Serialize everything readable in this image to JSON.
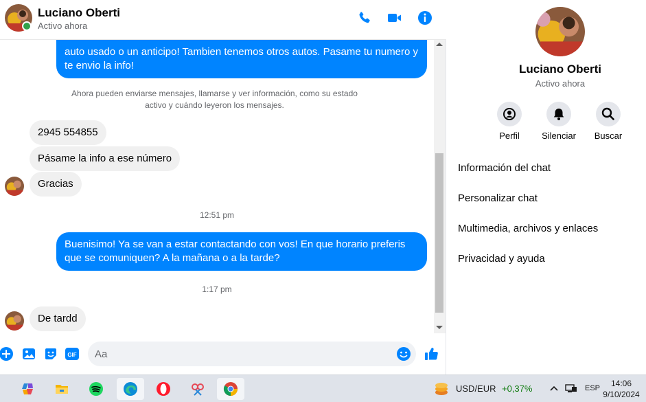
{
  "chat": {
    "contact_name": "Luciano Oberti",
    "contact_status": "Activo ahora",
    "messages": [
      {
        "type": "out",
        "text": "auto usado o un anticipo! Tambien tenemos otros autos. Pasame tu numero y te envio la info!"
      },
      {
        "type": "system",
        "text": "Ahora pueden enviarse mensajes, llamarse y ver información, como su estado activo y cuándo leyeron los mensajes."
      },
      {
        "type": "in",
        "text": "2945 554855"
      },
      {
        "type": "in",
        "text": "Pásame la info a ese número"
      },
      {
        "type": "in",
        "text": "Gracias"
      },
      {
        "type": "time",
        "text": "12:51 pm"
      },
      {
        "type": "out",
        "text": "Buenisimo! Ya se van a estar contactando con vos! En que horario preferis que se comuniquen? A la mañana o a la tarde?"
      },
      {
        "type": "time",
        "text": "1:17 pm"
      },
      {
        "type": "in",
        "text": "De tardd"
      }
    ],
    "composer": {
      "placeholder": "Aa",
      "value": ""
    }
  },
  "info_panel": {
    "name": "Luciano Oberti",
    "status": "Activo ahora",
    "actions": [
      "Perfil",
      "Silenciar",
      "Buscar"
    ],
    "menu": [
      "Información del chat",
      "Personalizar chat",
      "Multimedia, archivos y enlaces",
      "Privacidad y ayuda"
    ]
  },
  "taskbar": {
    "apps": [
      "copilot-icon",
      "file-explorer-icon",
      "spotify-icon",
      "edge-icon",
      "opera-icon",
      "snipping-tool-icon",
      "chrome-icon"
    ],
    "currency_pair": "USD/EUR",
    "currency_change": "+0,37%",
    "language": "ESP",
    "time": "14:06",
    "date": "9/10/2024"
  },
  "colors": {
    "accent": "#0084ff",
    "online": "#31a24c",
    "positive": "#0f7b0f"
  }
}
